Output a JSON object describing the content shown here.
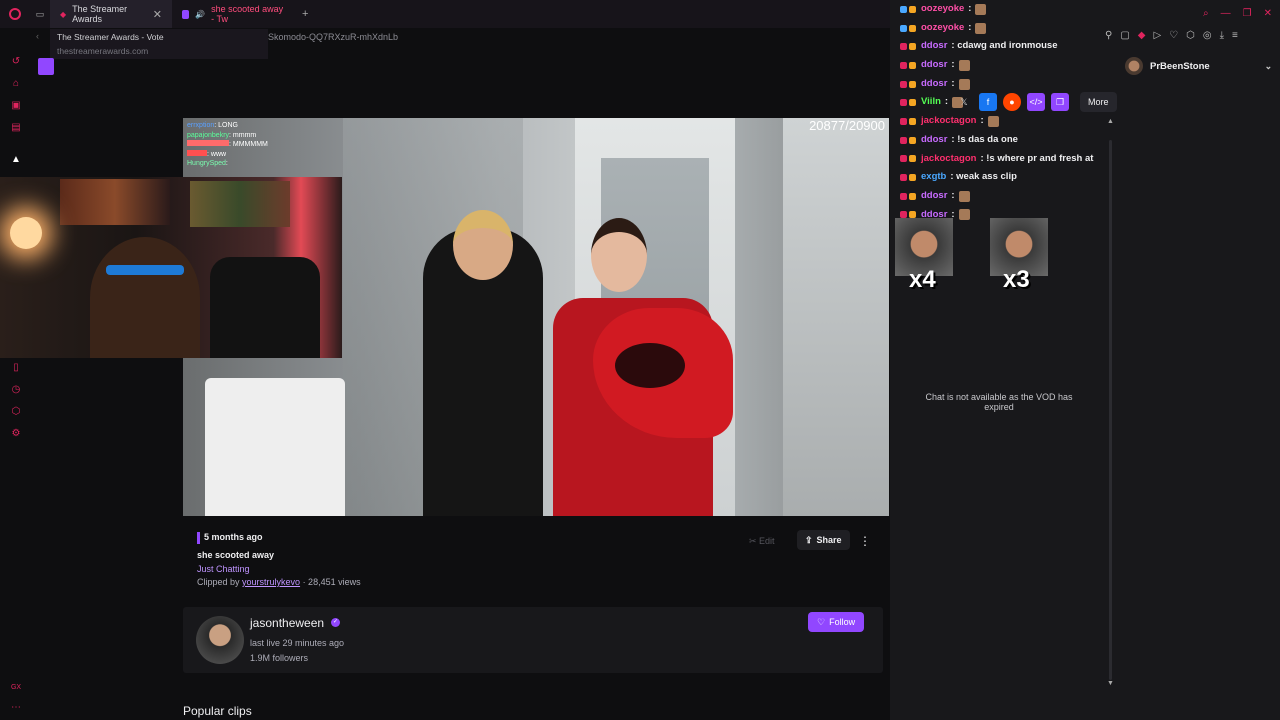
{
  "browser": {
    "tabs": [
      {
        "label": "The Streamer Awards",
        "close": "✕"
      },
      {
        "label": "she scooted away - Tw"
      }
    ],
    "new_tab": "+",
    "url_path": "-Skomodo-QQ7RXzuR-mhXdnLb",
    "tooltip": {
      "title": "The Streamer Awards - Vote",
      "url": "thestreamerawards.com"
    }
  },
  "video": {
    "frame_counter": "20877/20900",
    "overlay_chat": [
      {
        "user": "errxption",
        "text": "LONG",
        "color": "#5aa0ff"
      },
      {
        "user": "papajonbekry",
        "text": "mmmm",
        "color": "#5aff9a"
      },
      {
        "user": "",
        "text": "MMMMMM",
        "color": "#ff6b6b"
      },
      {
        "user": "",
        "text": "www",
        "color": "#ff5050"
      },
      {
        "user": "HungrySped",
        "text": "",
        "color": "#7affb0"
      }
    ]
  },
  "clip": {
    "ago": "5 months ago",
    "title": "she scooted away",
    "game": "Just Chatting",
    "clipped_by_prefix": "Clipped by ",
    "clipper": "yourstrulykevo",
    "views": " · 28,451 views",
    "edit_label": "Edit",
    "share_label": "Share"
  },
  "channel": {
    "name": "jasontheween",
    "last_live": "last live 29 minutes ago",
    "followers": "1.9M followers",
    "follow_label": "Follow"
  },
  "section": {
    "popular": "Popular clips"
  },
  "chat": {
    "messages": [
      {
        "user": "oozeyoke",
        "text": ":",
        "color": "#ff4fa7",
        "emote": true
      },
      {
        "user": "oozeyoke",
        "text": ":",
        "color": "#ff4fa7",
        "emote": true
      },
      {
        "user": "ddosr",
        "text": ": cdawg and ironmouse",
        "color": "#c86bff",
        "emote": false
      },
      {
        "user": "ddosr",
        "text": ":",
        "color": "#c86bff",
        "emote": true
      },
      {
        "user": "ddosr",
        "text": ":",
        "color": "#c86bff",
        "emote": true
      },
      {
        "user": "Viiln",
        "text": ":",
        "color": "#54ff54",
        "emote": true
      },
      {
        "user": "jackoctagon",
        "text": ":",
        "color": "#ff2f6e",
        "emote": true
      },
      {
        "user": "ddosr",
        "text": ": !s das da one",
        "color": "#c86bff",
        "emote": false
      },
      {
        "user": "jackoctagon",
        "text": ": !s where pr and fresh at",
        "color": "#ff2f6e",
        "emote": false
      },
      {
        "user": "exgtb",
        "text": ": weak ass clip",
        "color": "#4aa8ff",
        "emote": false
      },
      {
        "user": "ddosr",
        "text": ":",
        "color": "#c86bff",
        "emote": true
      },
      {
        "user": "ddosr",
        "text": ":",
        "color": "#c86bff",
        "emote": true
      }
    ],
    "combo": [
      {
        "count": "x4"
      },
      {
        "count": "x3"
      }
    ],
    "unavailable": "Chat is not available as the VOD has expired",
    "more_label": "More"
  },
  "user": {
    "name": "PrBeenStone"
  },
  "colors": {
    "accent": "#9147ff",
    "opera": "#e0245e"
  }
}
